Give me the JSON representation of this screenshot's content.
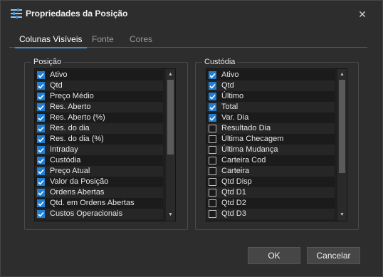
{
  "window": {
    "title": "Propriedades da Posição",
    "close_glyph": "✕",
    "accent": "#3a8fd6",
    "check_color": "#1e7fd4"
  },
  "tabs": [
    {
      "label": "Colunas Visíveis",
      "active": true
    },
    {
      "label": "Fonte",
      "active": false
    },
    {
      "label": "Cores",
      "active": false
    }
  ],
  "posicao": {
    "label": "Posição",
    "items": [
      {
        "label": "Ativo",
        "checked": true
      },
      {
        "label": "Qtd",
        "checked": true
      },
      {
        "label": "Preço Médio",
        "checked": true
      },
      {
        "label": "Res. Aberto",
        "checked": true
      },
      {
        "label": "Res. Aberto (%)",
        "checked": true
      },
      {
        "label": "Res. do dia",
        "checked": true
      },
      {
        "label": "Res. do dia (%)",
        "checked": true
      },
      {
        "label": "Intraday",
        "checked": true
      },
      {
        "label": "Custódia",
        "checked": true
      },
      {
        "label": "Preço Atual",
        "checked": true
      },
      {
        "label": "Valor da Posição",
        "checked": true
      },
      {
        "label": "Ordens Abertas",
        "checked": true
      },
      {
        "label": "Qtd. em Ordens Abertas",
        "checked": true
      },
      {
        "label": "Custos Operacionais",
        "checked": true
      }
    ]
  },
  "custodia": {
    "label": "Custódia",
    "items": [
      {
        "label": "Ativo",
        "checked": true
      },
      {
        "label": "Qtd",
        "checked": true
      },
      {
        "label": "Último",
        "checked": true
      },
      {
        "label": "Total",
        "checked": true
      },
      {
        "label": "Var. Dia",
        "checked": true
      },
      {
        "label": "Resultado Dia",
        "checked": false
      },
      {
        "label": "Última Checagem",
        "checked": false
      },
      {
        "label": "Última Mudança",
        "checked": false
      },
      {
        "label": "Carteira Cod",
        "checked": false
      },
      {
        "label": "Carteira",
        "checked": false
      },
      {
        "label": "Qtd Disp",
        "checked": false
      },
      {
        "label": "Qtd D1",
        "checked": false
      },
      {
        "label": "Qtd D2",
        "checked": false
      },
      {
        "label": "Qtd D3",
        "checked": false
      }
    ]
  },
  "buttons": {
    "ok": "OK",
    "cancel": "Cancelar"
  }
}
